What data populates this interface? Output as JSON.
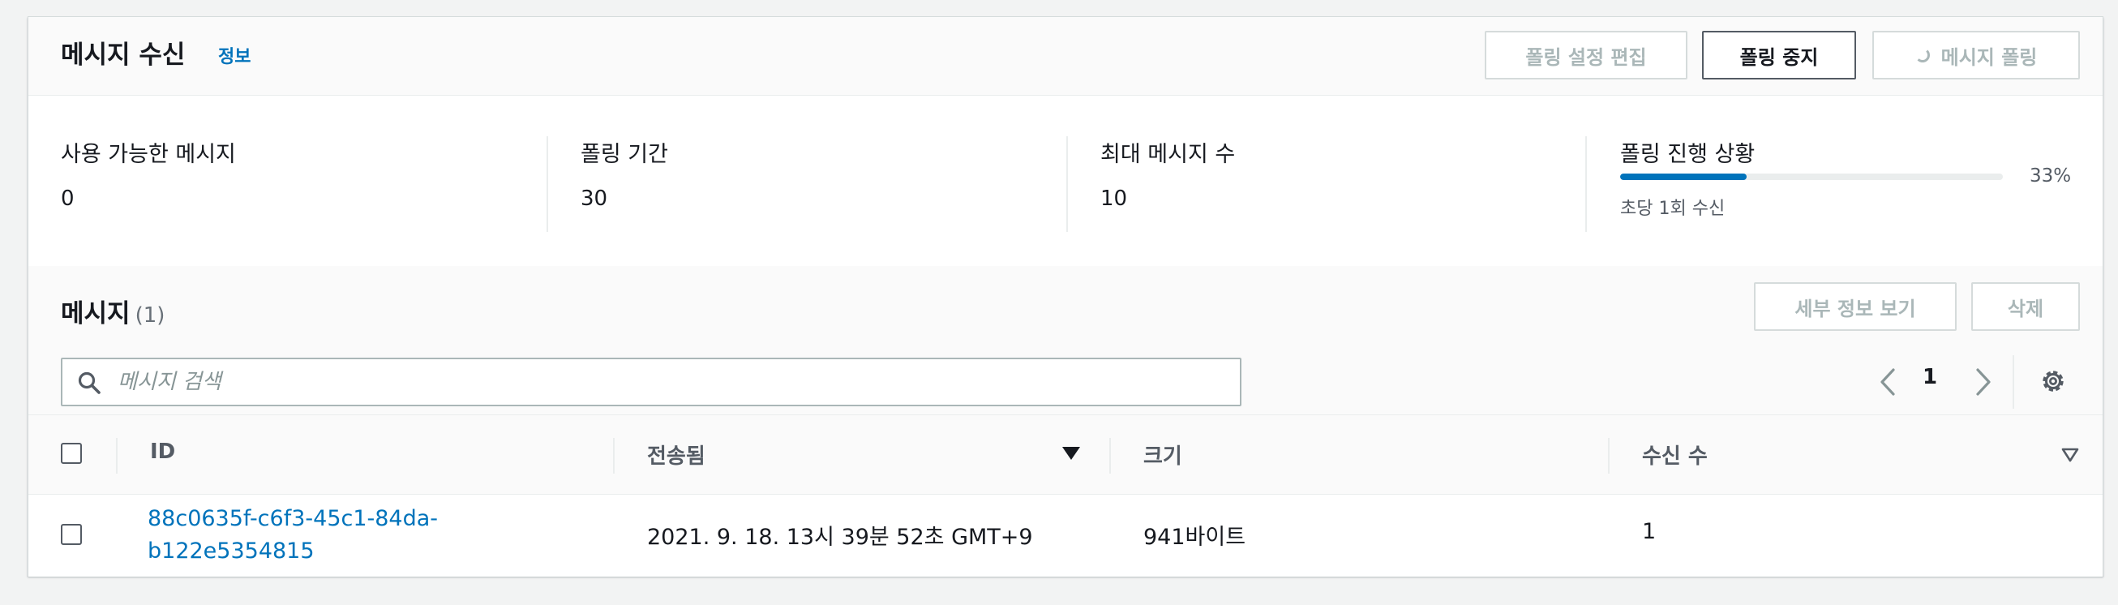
{
  "header": {
    "title": "메시지 수신",
    "info": "정보",
    "buttons": {
      "edit_polling": "폴링 설정 편집",
      "stop_polling": "폴링 중지",
      "poll_messages": "메시지 폴링"
    }
  },
  "stats": {
    "available": {
      "label": "사용 가능한 메시지",
      "value": "0"
    },
    "duration": {
      "label": "폴링 기간",
      "value": "30"
    },
    "max_messages": {
      "label": "최대 메시지 수",
      "value": "10"
    },
    "progress": {
      "label": "폴링 진행 상황",
      "percent_text": "33%",
      "fraction": 0.33,
      "sub": "초당 1회 수신"
    }
  },
  "messages": {
    "title": "메시지",
    "count": "(1)",
    "buttons": {
      "view_details": "세부 정보 보기",
      "delete": "삭제"
    },
    "search_placeholder": "메시지 검색",
    "page": "1"
  },
  "table": {
    "columns": {
      "id": "ID",
      "sent": "전송됨",
      "size": "크기",
      "receive_count": "수신 수"
    },
    "rows": [
      {
        "id_line1": "88c0635f-c6f3-45c1-84da-",
        "id_line2": "b122e5354815",
        "sent": "2021. 9. 18. 13시 39분 52초 GMT+9",
        "size": "941바이트",
        "receive_count": "1"
      }
    ]
  },
  "colors": {
    "accent": "#0073bb",
    "text": "#16191f",
    "muted": "#545b64",
    "disabled": "#aab7b8"
  },
  "icons": [
    "search-icon",
    "chevron-left-icon",
    "chevron-right-icon",
    "settings-gear-icon",
    "sort-descending-icon",
    "sort-outline-icon",
    "spinner-icon"
  ]
}
